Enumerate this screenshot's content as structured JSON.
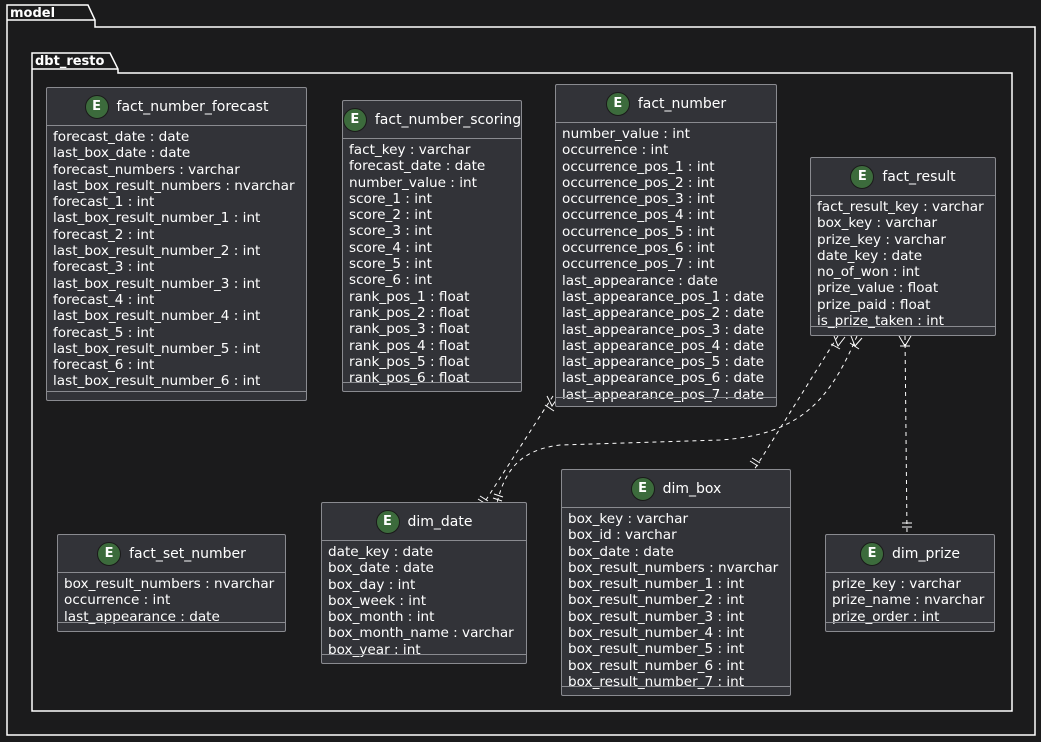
{
  "packages": {
    "outer": "model",
    "inner": "dbt_resto"
  },
  "entity_badge": "E",
  "entities": {
    "fact_number_forecast": {
      "name": "fact_number_forecast",
      "attributes": [
        "forecast_date : date",
        "last_box_date : date",
        "forecast_numbers : varchar",
        "last_box_result_numbers : nvarchar",
        "forecast_1 : int",
        "last_box_result_number_1 : int",
        "forecast_2 : int",
        "last_box_result_number_2 : int",
        "forecast_3 : int",
        "last_box_result_number_3 : int",
        "forecast_4 : int",
        "last_box_result_number_4 : int",
        "forecast_5 : int",
        "last_box_result_number_5 : int",
        "forecast_6 : int",
        "last_box_result_number_6 : int"
      ]
    },
    "fact_number_scoring": {
      "name": "fact_number_scoring",
      "attributes": [
        "fact_key : varchar",
        "forecast_date : date",
        "number_value : int",
        "score_1 : int",
        "score_2 : int",
        "score_3 : int",
        "score_4 : int",
        "score_5 : int",
        "score_6 : int",
        "rank_pos_1 : float",
        "rank_pos_2 : float",
        "rank_pos_3 : float",
        "rank_pos_4 : float",
        "rank_pos_5 : float",
        "rank_pos_6 : float"
      ]
    },
    "fact_number": {
      "name": "fact_number",
      "attributes": [
        "number_value : int",
        "occurrence : int",
        "occurrence_pos_1 : int",
        "occurrence_pos_2 : int",
        "occurrence_pos_3 : int",
        "occurrence_pos_4 : int",
        "occurrence_pos_5 : int",
        "occurrence_pos_6 : int",
        "occurrence_pos_7 : int",
        "last_appearance : date",
        "last_appearance_pos_1 : date",
        "last_appearance_pos_2 : date",
        "last_appearance_pos_3 : date",
        "last_appearance_pos_4 : date",
        "last_appearance_pos_5 : date",
        "last_appearance_pos_6 : date",
        "last_appearance_pos_7 : date"
      ]
    },
    "fact_result": {
      "name": "fact_result",
      "attributes": [
        "fact_result_key : varchar",
        "box_key : varchar",
        "prize_key : varchar",
        "date_key : date",
        "no_of_won : int",
        "prize_value : float",
        "prize_paid : float",
        "is_prize_taken : int"
      ]
    },
    "fact_set_number": {
      "name": "fact_set_number",
      "attributes": [
        "box_result_numbers : nvarchar",
        "occurrence : int",
        "last_appearance : date"
      ]
    },
    "dim_date": {
      "name": "dim_date",
      "attributes": [
        "date_key : date",
        "box_date : date",
        "box_day : int",
        "box_week : int",
        "box_month : int",
        "box_month_name : varchar",
        "box_year : int"
      ]
    },
    "dim_box": {
      "name": "dim_box",
      "attributes": [
        "box_key : varchar",
        "box_id : varchar",
        "box_date : date",
        "box_result_numbers : nvarchar",
        "box_result_number_1 : int",
        "box_result_number_2 : int",
        "box_result_number_3 : int",
        "box_result_number_4 : int",
        "box_result_number_5 : int",
        "box_result_number_6 : int",
        "box_result_number_7 : int"
      ]
    },
    "dim_prize": {
      "name": "dim_prize",
      "attributes": [
        "prize_key : varchar",
        "prize_name : nvarchar",
        "prize_order : int"
      ]
    }
  },
  "relationships": [
    {
      "from": "fact_number",
      "to": "dim_date",
      "from_cardinality": "one-or-many",
      "to_cardinality": "exactly-one"
    },
    {
      "from": "fact_result",
      "to": "dim_date",
      "from_cardinality": "one-or-many",
      "to_cardinality": "exactly-one"
    },
    {
      "from": "fact_result",
      "to": "dim_box",
      "from_cardinality": "one-or-many",
      "to_cardinality": "exactly-one"
    },
    {
      "from": "fact_result",
      "to": "dim_prize",
      "from_cardinality": "one-or-many",
      "to_cardinality": "exactly-one"
    }
  ],
  "colors": {
    "background": "#1b1b1c",
    "entity_fill": "#323338",
    "entity_border": "#8a8b90",
    "badge_fill": "#3c6b3c",
    "line": "#ffffff"
  }
}
